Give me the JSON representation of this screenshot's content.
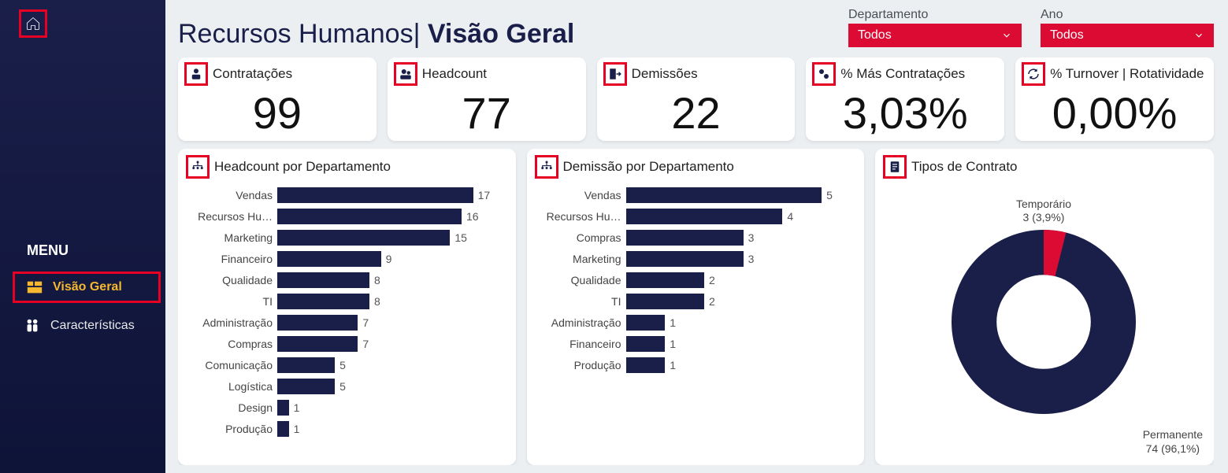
{
  "sidebar": {
    "menu_title": "MENU",
    "items": [
      {
        "label": "Visão Geral",
        "active": true
      },
      {
        "label": "Características",
        "active": false
      }
    ]
  },
  "header": {
    "title_prefix": "Recursos Humanos",
    "title_separator": "|",
    "title_bold": "Visão Geral"
  },
  "filters": {
    "department": {
      "label": "Departamento",
      "value": "Todos"
    },
    "year": {
      "label": "Ano",
      "value": "Todos"
    }
  },
  "kpis": [
    {
      "label": "Contratações",
      "value": "99"
    },
    {
      "label": "Headcount",
      "value": "77"
    },
    {
      "label": "Demissões",
      "value": "22"
    },
    {
      "label": "% Más Contratações",
      "value": "3,03%"
    },
    {
      "label": "% Turnover | Rotatividade",
      "value": "0,00%"
    }
  ],
  "charts": {
    "headcount_dept": {
      "title": "Headcount por Departamento",
      "max": 17
    },
    "dismissal_dept": {
      "title": "Demissão por Departamento",
      "max": 5
    },
    "contract_types": {
      "title": "Tipos de Contrato",
      "temp_label": "Temporário",
      "temp_sub": "3 (3,9%)",
      "perm_label": "Permanente",
      "perm_sub": "74 (96,1%)"
    }
  },
  "chart_data": [
    {
      "type": "bar",
      "title": "Headcount por Departamento",
      "orientation": "horizontal",
      "categories": [
        "Vendas",
        "Recursos Hu…",
        "Marketing",
        "Financeiro",
        "Qualidade",
        "TI",
        "Administração",
        "Compras",
        "Comunicação",
        "Logística",
        "Design",
        "Produção"
      ],
      "values": [
        17,
        16,
        15,
        9,
        8,
        8,
        7,
        7,
        5,
        5,
        1,
        1
      ],
      "xlabel": "",
      "ylabel": "",
      "xlim": [
        0,
        17
      ]
    },
    {
      "type": "bar",
      "title": "Demissão por Departamento",
      "orientation": "horizontal",
      "categories": [
        "Vendas",
        "Recursos Hu…",
        "Compras",
        "Marketing",
        "Qualidade",
        "TI",
        "Administração",
        "Financeiro",
        "Produção"
      ],
      "values": [
        5,
        4,
        3,
        3,
        2,
        2,
        1,
        1,
        1
      ],
      "xlabel": "",
      "ylabel": "",
      "xlim": [
        0,
        5
      ]
    },
    {
      "type": "pie",
      "title": "Tipos de Contrato",
      "labels": [
        "Permanente",
        "Temporário"
      ],
      "values": [
        74,
        3
      ],
      "percentages": [
        96.1,
        3.9
      ],
      "colors": [
        "#1a1f4a",
        "#dc0b33"
      ]
    }
  ]
}
